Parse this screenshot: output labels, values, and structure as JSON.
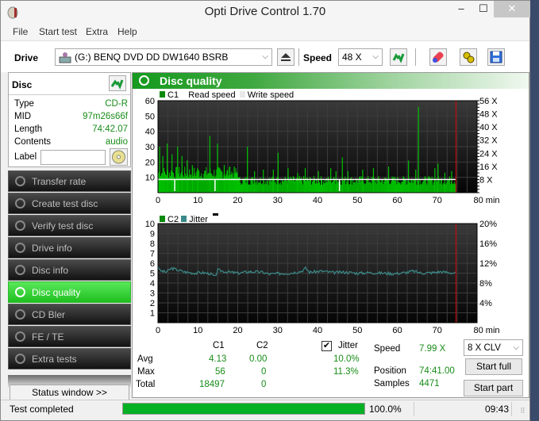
{
  "window": {
    "title": "Opti Drive Control 1.70",
    "minimize_glyph": "–",
    "maximize_glyph": "☐",
    "close_glyph": "✕"
  },
  "menu": [
    "File",
    "Start test",
    "Extra",
    "Help"
  ],
  "toolbar": {
    "drive_label": "Drive",
    "drive_value": "(G:)  BENQ DVD DD DW1640 BSRB",
    "speed_label": "Speed",
    "speed_value": "48 X",
    "icons": [
      "drive-icon",
      "eject-icon",
      "refresh-icon",
      "erase-icon",
      "settings-icon",
      "save-icon"
    ]
  },
  "disc": {
    "header": "Disc",
    "fields": [
      {
        "key": "Type",
        "value": "CD-R"
      },
      {
        "key": "MID",
        "value": "97m26s66f"
      },
      {
        "key": "Length",
        "value": "74:42.07"
      },
      {
        "key": "Contents",
        "value": "audio"
      }
    ],
    "label_key": "Label",
    "label_value": ""
  },
  "nav": [
    {
      "label": "Transfer rate",
      "active": false
    },
    {
      "label": "Create test disc",
      "active": false
    },
    {
      "label": "Verify test disc",
      "active": false
    },
    {
      "label": "Drive info",
      "active": false
    },
    {
      "label": "Disc info",
      "active": false
    },
    {
      "label": "Disc quality",
      "active": true
    },
    {
      "label": "CD Bler",
      "active": false
    },
    {
      "label": "FE / TE",
      "active": false
    },
    {
      "label": "Extra tests",
      "active": false
    }
  ],
  "status_window_label": "Status window >>",
  "panel": {
    "title": "Disc quality"
  },
  "chart_data": [
    {
      "type": "bar",
      "title": "C1 / Read speed",
      "legend": [
        "C1",
        "Read speed",
        "Write speed"
      ],
      "colors": {
        "c1": "#00c000",
        "read": "#ffffff",
        "write": "#e8e8e8",
        "marker": "#e00000"
      },
      "x_ticks": [
        0,
        10,
        20,
        30,
        40,
        50,
        60,
        70,
        80
      ],
      "x_unit": "min",
      "xlim": [
        0,
        80
      ],
      "ylim": [
        0,
        60
      ],
      "y_ticks": [
        10,
        20,
        30,
        40,
        50,
        60
      ],
      "y2_ticks": [
        "8 X",
        "16 X",
        "24 X",
        "32 X",
        "40 X",
        "48 X",
        "56 X"
      ],
      "y2lim": [
        0,
        56
      ],
      "end_marker_min": 74.7,
      "read_speed_x": 8,
      "c1_peaks": [
        {
          "x": 0.3,
          "y": 30
        },
        {
          "x": 1.1,
          "y": 24
        },
        {
          "x": 2.2,
          "y": 32
        },
        {
          "x": 3.4,
          "y": 25
        },
        {
          "x": 4.8,
          "y": 30
        },
        {
          "x": 5.9,
          "y": 24
        },
        {
          "x": 7.2,
          "y": 21
        },
        {
          "x": 8.5,
          "y": 18
        },
        {
          "x": 9.8,
          "y": 16
        },
        {
          "x": 12.9,
          "y": 37
        },
        {
          "x": 14.8,
          "y": 32
        },
        {
          "x": 16.5,
          "y": 18
        },
        {
          "x": 17.9,
          "y": 17
        },
        {
          "x": 19.0,
          "y": 17
        },
        {
          "x": 22.3,
          "y": 30
        },
        {
          "x": 24.1,
          "y": 14
        },
        {
          "x": 26.3,
          "y": 15
        },
        {
          "x": 28.8,
          "y": 15
        },
        {
          "x": 30.0,
          "y": 26
        },
        {
          "x": 32.5,
          "y": 16
        },
        {
          "x": 34.9,
          "y": 13
        },
        {
          "x": 36.8,
          "y": 16
        },
        {
          "x": 40.1,
          "y": 14
        },
        {
          "x": 43.2,
          "y": 16
        },
        {
          "x": 44.5,
          "y": 14
        },
        {
          "x": 46.1,
          "y": 23
        },
        {
          "x": 47.5,
          "y": 14
        },
        {
          "x": 51.2,
          "y": 15
        },
        {
          "x": 53.9,
          "y": 16
        },
        {
          "x": 57.7,
          "y": 17
        },
        {
          "x": 62.7,
          "y": 21
        },
        {
          "x": 64.5,
          "y": 15
        },
        {
          "x": 65.2,
          "y": 56
        },
        {
          "x": 69.3,
          "y": 16
        },
        {
          "x": 70.1,
          "y": 19
        },
        {
          "x": 71.8,
          "y": 13
        },
        {
          "x": 73.5,
          "y": 14
        }
      ]
    },
    {
      "type": "line",
      "title": "C2 / Jitter",
      "legend": [
        "C2",
        "Jitter"
      ],
      "colors": {
        "c2": "#00c000",
        "jitter": "#3a8a88",
        "marker": "#e00000"
      },
      "x_ticks": [
        0,
        10,
        20,
        30,
        40,
        50,
        60,
        70,
        80
      ],
      "x_unit": "min",
      "xlim": [
        0,
        80
      ],
      "ylim": [
        0,
        10
      ],
      "y_ticks": [
        1,
        2,
        3,
        4,
        5,
        6,
        7,
        8,
        9,
        10
      ],
      "y2_ticks": [
        "4%",
        "8%",
        "12%",
        "16%",
        "20%"
      ],
      "y2lim": [
        0,
        20
      ],
      "end_marker_min": 74.7,
      "jitter_pct": [
        {
          "x": 0,
          "y": 11.5
        },
        {
          "x": 0.5,
          "y": 10.5
        },
        {
          "x": 2,
          "y": 10.2
        },
        {
          "x": 3.5,
          "y": 11.0
        },
        {
          "x": 5,
          "y": 10.6
        },
        {
          "x": 7,
          "y": 10.2
        },
        {
          "x": 9,
          "y": 10.0
        },
        {
          "x": 11,
          "y": 10.1
        },
        {
          "x": 13,
          "y": 9.9
        },
        {
          "x": 14.3,
          "y": 9.3
        },
        {
          "x": 15,
          "y": 10.6
        },
        {
          "x": 17,
          "y": 10.3
        },
        {
          "x": 20,
          "y": 10.0
        },
        {
          "x": 23,
          "y": 10.3
        },
        {
          "x": 26,
          "y": 10.2
        },
        {
          "x": 28,
          "y": 9.8
        },
        {
          "x": 30,
          "y": 9.9
        },
        {
          "x": 33,
          "y": 10.0
        },
        {
          "x": 36,
          "y": 10.4
        },
        {
          "x": 37,
          "y": 11.0
        },
        {
          "x": 38,
          "y": 10.2
        },
        {
          "x": 41,
          "y": 10.4
        },
        {
          "x": 44,
          "y": 10.1
        },
        {
          "x": 47,
          "y": 10.2
        },
        {
          "x": 50,
          "y": 10.0
        },
        {
          "x": 53,
          "y": 10.1
        },
        {
          "x": 56,
          "y": 10.0
        },
        {
          "x": 59,
          "y": 9.9
        },
        {
          "x": 62,
          "y": 10.1
        },
        {
          "x": 64,
          "y": 10.4
        },
        {
          "x": 66,
          "y": 10.0
        },
        {
          "x": 69,
          "y": 10.1
        },
        {
          "x": 71,
          "y": 10.3
        },
        {
          "x": 73,
          "y": 10.1
        },
        {
          "x": 74.7,
          "y": 10.0
        }
      ],
      "c2_values": 0
    }
  ],
  "stats": {
    "col_c1": "C1",
    "col_c2": "C2",
    "jitter_label": "Jitter",
    "jitter_checked": true,
    "rows": [
      {
        "label": "Avg",
        "c1": "4.13",
        "c2": "0.00",
        "jitter": "10.0%"
      },
      {
        "label": "Max",
        "c1": "56",
        "c2": "0",
        "jitter": "11.3%"
      },
      {
        "label": "Total",
        "c1": "18497",
        "c2": "0",
        "jitter": ""
      }
    ],
    "speed_label": "Speed",
    "speed_value": "7.99 X",
    "position_label": "Position",
    "position_value": "74:41.00",
    "samples_label": "Samples",
    "samples_value": "4471",
    "test_speed_select": "8 X CLV",
    "start_full": "Start full",
    "start_part": "Start part"
  },
  "statusbar": {
    "text": "Test completed",
    "progress": 100.0,
    "progress_text": "100.0%",
    "time": "09:43"
  }
}
